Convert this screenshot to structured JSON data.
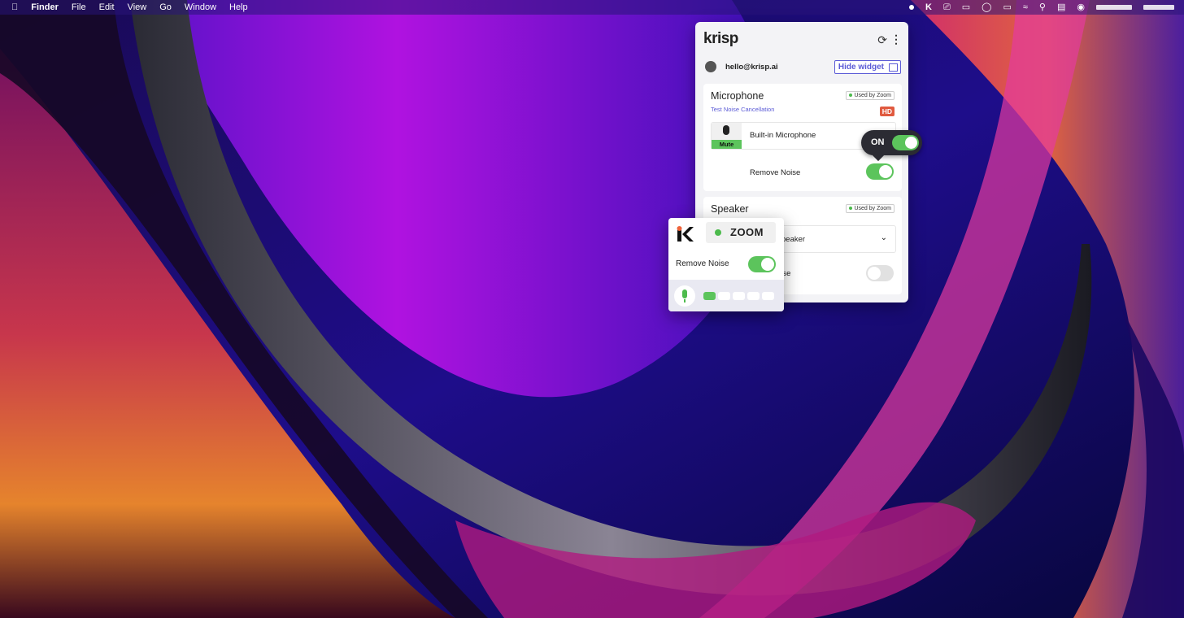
{
  "menubar": {
    "apple_icon": "apple-logo-icon",
    "app_name": "Finder",
    "menus": [
      "File",
      "Edit",
      "View",
      "Go",
      "Window",
      "Help"
    ]
  },
  "krisp_panel": {
    "logo": "krisp",
    "user_email": "hello@krisp.ai",
    "hide_widget_label": "Hide widget",
    "microphone": {
      "title": "Microphone",
      "used_by": "Used by Zoom",
      "test_link": "Test Noise Cancellation",
      "hd_badge": "HD",
      "mute_label": "Mute",
      "device_name": "Built-in Microphone",
      "remove_noise_label": "Remove Noise",
      "remove_noise_on": true
    },
    "speaker": {
      "title": "Speaker",
      "used_by": "Used by Zoom",
      "device_name_visible": "peaker",
      "remove_noise_visible": "oise",
      "remove_noise_on": false
    }
  },
  "on_pill": {
    "label": "ON",
    "on": true
  },
  "mini_widget": {
    "app_label": "ZOOM",
    "remove_noise_label": "Remove Noise",
    "remove_noise_on": true,
    "meter_level": 0.2
  },
  "colors": {
    "accent_purple": "#5b5bd6",
    "toggle_green": "#5cc45c",
    "hd_red": "#e05a3f",
    "krisp_orange": "#f0643c"
  }
}
